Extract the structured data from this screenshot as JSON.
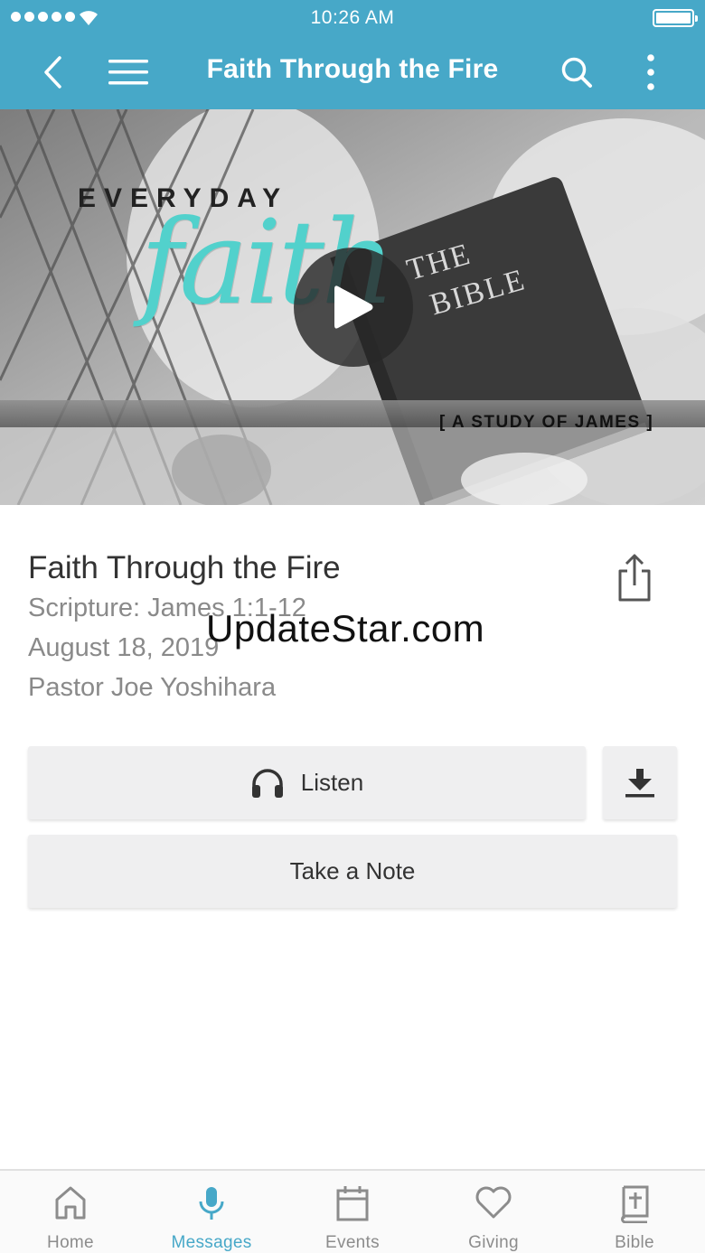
{
  "status_bar": {
    "time": "10:26 AM"
  },
  "nav": {
    "title": "Faith Through the Fire",
    "back_icon": "chevron-left-icon",
    "menu_icon": "hamburger-menu-icon",
    "search_icon": "search-icon",
    "more_icon": "vertical-dots-icon",
    "bar_color": "#47a8c8"
  },
  "hero": {
    "series_top": "EVERYDAY",
    "series_script": "faith",
    "book_title_line1": "THE",
    "book_title_line2": "BIBLE",
    "series_sub": "[ A STUDY OF JAMES ]",
    "play_icon": "play-icon",
    "accent_color": "#52d1cc"
  },
  "message": {
    "title": "Faith Through the Fire",
    "scripture": "Scripture: James 1:1-12",
    "date": "August 18, 2019",
    "speaker": "Pastor Joe Yoshihara",
    "share_icon": "share-icon"
  },
  "watermark": "UpdateStar.com",
  "actions": {
    "listen_label": "Listen",
    "listen_icon": "headphones-icon",
    "download_icon": "download-icon",
    "note_label": "Take a Note"
  },
  "tabs": [
    {
      "label": "Home",
      "icon": "home-icon",
      "active": false
    },
    {
      "label": "Messages",
      "icon": "microphone-icon",
      "active": true
    },
    {
      "label": "Events",
      "icon": "calendar-icon",
      "active": false
    },
    {
      "label": "Giving",
      "icon": "heart-icon",
      "active": false
    },
    {
      "label": "Bible",
      "icon": "bible-icon",
      "active": false
    }
  ]
}
